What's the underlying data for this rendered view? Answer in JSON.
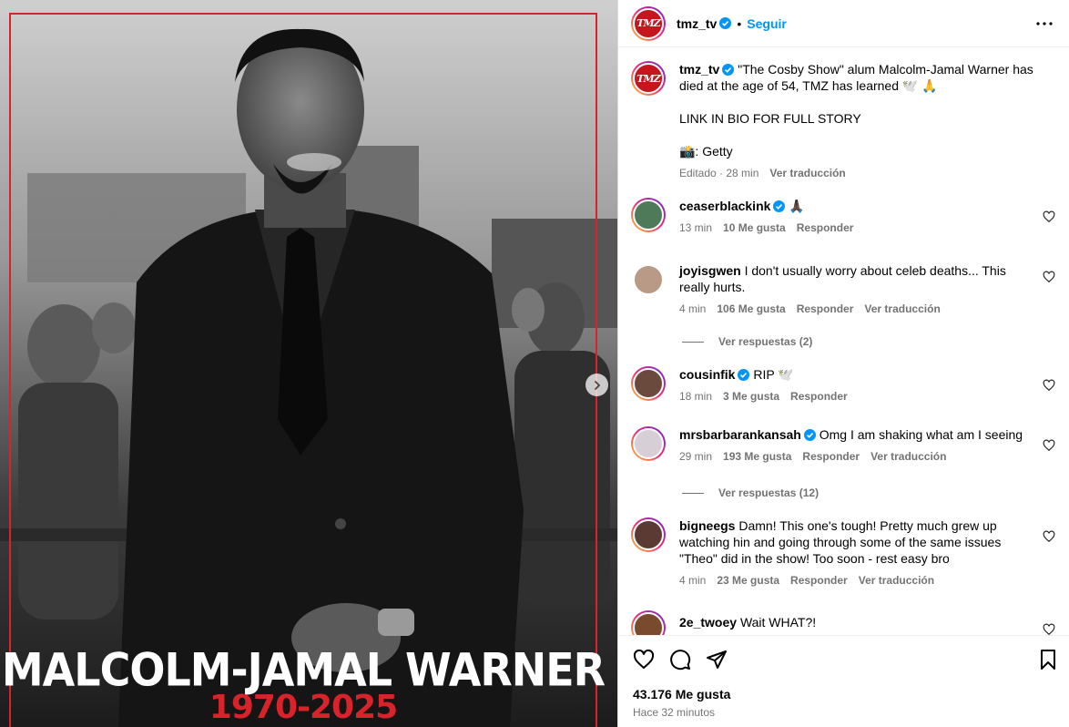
{
  "post": {
    "headline_name": "MALCOLM-JAMAL WARNER",
    "headline_years": "1970-2025"
  },
  "header": {
    "username": "tmz_tv",
    "avatar_text": "TMZ",
    "separator": "•",
    "follow_label": "Seguir"
  },
  "caption": {
    "username": "tmz_tv",
    "text": "\"The Cosby Show\" alum Malcolm-Jamal Warner has died at the age of 54, TMZ has learned 🕊️ 🙏",
    "line2": "LINK IN BIO FOR FULL STORY",
    "line3": "📸: Getty",
    "meta": "Editado · 28 min",
    "translate": "Ver traducción"
  },
  "comments": [
    {
      "username": "ceaserblackink",
      "verified": true,
      "text": "🙏🏿",
      "time": "13 min",
      "likes": "10 Me gusta",
      "reply": "Responder",
      "translate": ""
    },
    {
      "username": "joyisgwen",
      "verified": false,
      "text": "I don't usually worry about celeb deaths... This really hurts.",
      "time": "4 min",
      "likes": "106 Me gusta",
      "reply": "Responder",
      "translate": "Ver traducción",
      "view_replies": "Ver respuestas (2)"
    },
    {
      "username": "cousinfik",
      "verified": true,
      "text": "RIP 🕊️",
      "time": "18 min",
      "likes": "3 Me gusta",
      "reply": "Responder",
      "translate": ""
    },
    {
      "username": "mrsbarbarankansah",
      "verified": true,
      "text": "Omg I am shaking what am I seeing",
      "time": "29 min",
      "likes": "193 Me gusta",
      "reply": "Responder",
      "translate": "Ver traducción",
      "view_replies": "Ver respuestas (12)"
    },
    {
      "username": "bigneegs",
      "verified": false,
      "text": "Damn! This one's tough! Pretty much grew up watching hin and going through some of the same issues \"Theo\" did in the show! Too soon - rest easy bro",
      "time": "4 min",
      "likes": "23 Me gusta",
      "reply": "Responder",
      "translate": "Ver traducción"
    },
    {
      "username": "2e_twoey",
      "verified": false,
      "text": "Wait WHAT?!",
      "time": "",
      "likes": "",
      "reply": "",
      "translate": ""
    }
  ],
  "footer": {
    "likes": "43.176 Me gusta",
    "time_ago": "Hace 32 minutos"
  },
  "colors": {
    "accent_blue": "#0095f6",
    "tmz_red": "#d9232a",
    "muted_text": "#737373"
  },
  "icons": [
    "verified-icon",
    "more-options-icon",
    "chevron-right-icon",
    "heart-icon",
    "comment-icon",
    "share-icon",
    "bookmark-icon"
  ]
}
